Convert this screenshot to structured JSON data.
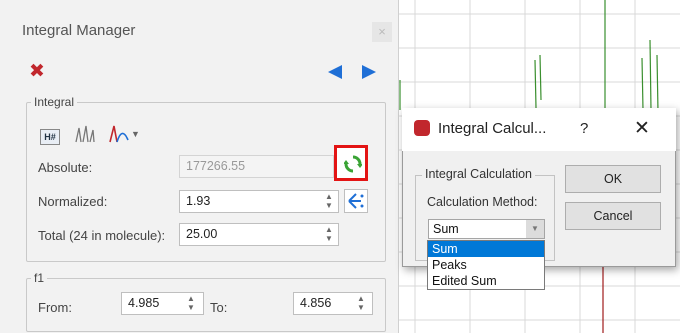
{
  "integral_manager": {
    "title": "Integral Manager",
    "close_glyph": "×",
    "group_integral": "Integral",
    "absolute_label": "Absolute:",
    "absolute_value": "177266.55",
    "normalized_label": "Normalized:",
    "normalized_value": "1.93",
    "total_label": "Total (24 in molecule):",
    "total_value": "25.00",
    "group_f1": "f1",
    "from_label": "From:",
    "from_value": "4.985",
    "to_label": "To:",
    "to_value": "4.856",
    "h_icon_text": "H#"
  },
  "dialog": {
    "title": "Integral Calcul...",
    "help": "?",
    "close": "✕",
    "group_title": "Integral Calculation",
    "method_label": "Calculation Method:",
    "method_value": "Sum",
    "ok_label": "OK",
    "cancel_label": "Cancel",
    "options": [
      "Sum",
      "Peaks",
      "Edited Sum"
    ],
    "selected_option": "Sum"
  },
  "colors": {
    "accent_blue": "#1f6fd6",
    "delete_red": "#c1272d",
    "highlight_red": "#e31414",
    "refresh_green": "#3aa335",
    "selection_blue": "#0078d7",
    "plot_green": "#3a8f2e"
  },
  "icons": [
    "delete-x-icon",
    "nav-prev-icon",
    "nav-next-icon",
    "h-number-icon",
    "peaks-icon",
    "curve-icon",
    "refresh-icon",
    "peak-pick-icon",
    "app-logo-icon"
  ]
}
